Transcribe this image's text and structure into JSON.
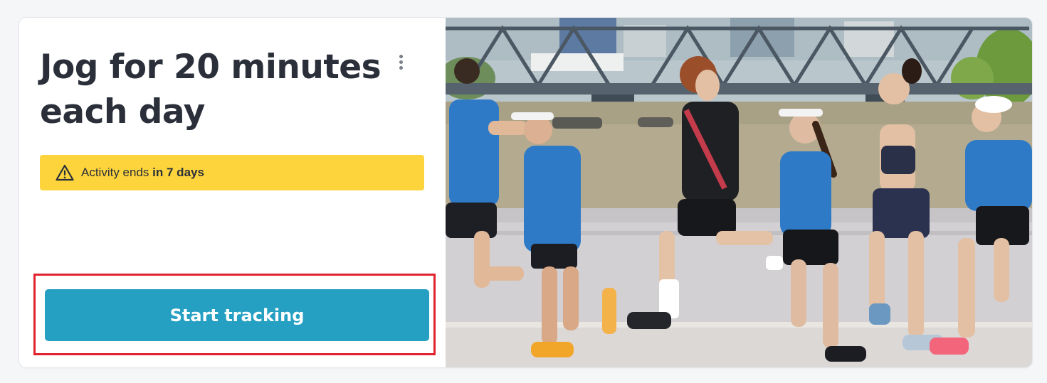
{
  "card": {
    "title": "Jog for 20 minutes each day",
    "menu_icon": "more-vertical-icon",
    "banner": {
      "icon": "warning-triangle-icon",
      "prefix": "Activity ends",
      "emphasis": "in 7 days",
      "background": "#fdd43c"
    },
    "action": {
      "label": "Start tracking",
      "color": "#26a0c2",
      "highlight_color": "#e0232e"
    },
    "image": {
      "subject": "group of runners jogging along a riverside walkway beneath a steel truss bridge"
    }
  }
}
